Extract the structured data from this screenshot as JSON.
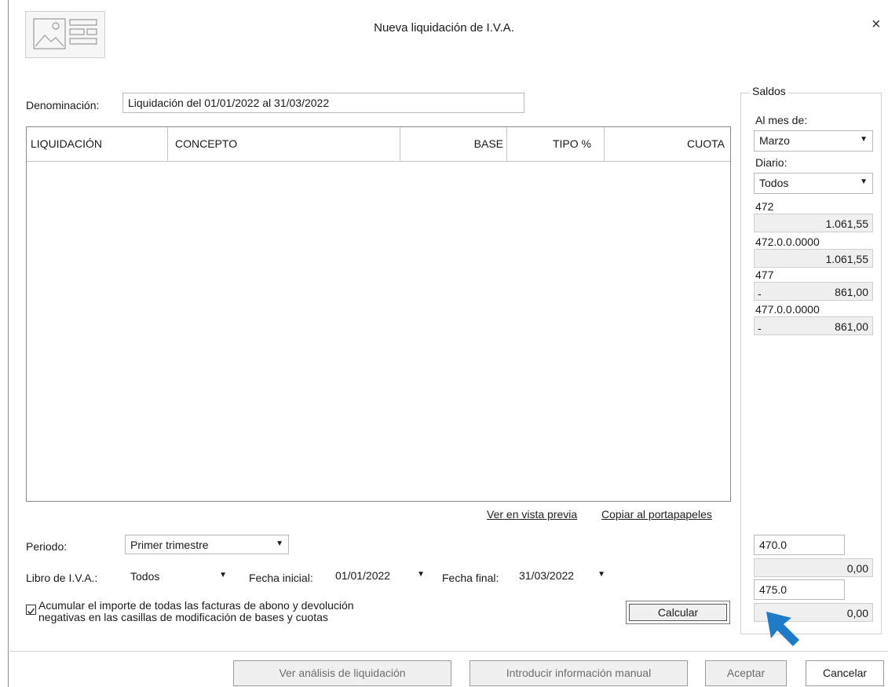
{
  "window": {
    "title": "Nueva liquidación de I.V.A.",
    "close_glyph": "×"
  },
  "denominacion": {
    "label": "Denominación:",
    "value": "Liquidación del 01/01/2022 al 31/03/2022"
  },
  "grid": {
    "columns": [
      "LIQUIDACIÓN",
      "CONCEPTO",
      "BASE",
      "TIPO %",
      "CUOTA"
    ],
    "rows": []
  },
  "links": {
    "preview": "Ver en vista previa",
    "copy": "Copiar al portapapeles"
  },
  "periodo": {
    "label": "Periodo:",
    "value": "Primer trimestre"
  },
  "libro": {
    "label": "Libro de I.V.A.:",
    "value": "Todos"
  },
  "fecha_inicial": {
    "label": "Fecha inicial:",
    "value": "01/01/2022"
  },
  "fecha_final": {
    "label": "Fecha final:",
    "value": "31/03/2022"
  },
  "acumular": {
    "checked": true,
    "line1": "Acumular el importe de todas las facturas de abono y devolución",
    "line2": "negativas en las casillas de modificación de bases y cuotas"
  },
  "calcular_label": "Calcular",
  "saldos": {
    "title": "Saldos",
    "mes_label": "Al mes de:",
    "mes_value": "Marzo",
    "diario_label": "Diario:",
    "diario_value": "Todos",
    "accounts": [
      {
        "name": "472",
        "prefix": "",
        "value": "1.061,55"
      },
      {
        "name": "472.0.0.0000",
        "prefix": "",
        "value": "1.061,55"
      },
      {
        "name": "477",
        "prefix": "-",
        "value": "861,00"
      },
      {
        "name": "477.0.0.0000",
        "prefix": "-",
        "value": "861,00"
      }
    ],
    "cuenta_470": {
      "code": "470.0",
      "value": "0,00"
    },
    "cuenta_475": {
      "code": "475.0",
      "value": "0,00"
    }
  },
  "footer": {
    "analisis": "Ver análisis de liquidación",
    "manual": "Introducir información manual",
    "aceptar": "Aceptar",
    "cancelar": "Cancelar"
  },
  "colors": {
    "cursor_arrow": "#1f7ac7"
  }
}
